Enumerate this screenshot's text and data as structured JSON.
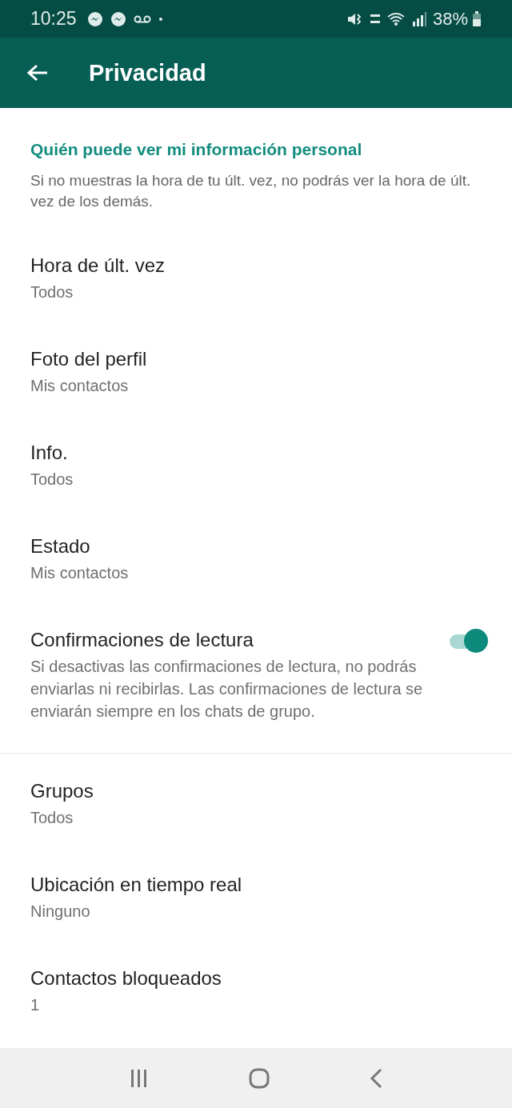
{
  "status_bar": {
    "time": "10:25",
    "battery": "38%"
  },
  "app_bar": {
    "title": "Privacidad"
  },
  "section": {
    "title": "Quién puede ver mi información personal",
    "description": "Si no muestras la hora de tu últ. vez, no podrás ver la hora de últ. vez de los demás."
  },
  "items": [
    {
      "kind": "option",
      "title": "Hora de últ. vez",
      "value": "Todos"
    },
    {
      "kind": "option",
      "title": "Foto del perfil",
      "value": "Mis contactos"
    },
    {
      "kind": "option",
      "title": "Info.",
      "value": "Todos"
    },
    {
      "kind": "option",
      "title": "Estado",
      "value": "Mis contactos"
    },
    {
      "kind": "toggle",
      "title": "Confirmaciones de lectura",
      "description": "Si desactivas las confirmaciones de lectura, no podrás enviarlas ni recibirlas. Las confirmaciones de lectura se enviarán siempre en los chats de grupo.",
      "on": true
    },
    {
      "kind": "divider"
    },
    {
      "kind": "option",
      "title": "Grupos",
      "value": "Todos"
    },
    {
      "kind": "option",
      "title": "Ubicación en tiempo real",
      "value": "Ninguno"
    },
    {
      "kind": "option",
      "title": "Contactos bloqueados",
      "value": "1"
    }
  ]
}
